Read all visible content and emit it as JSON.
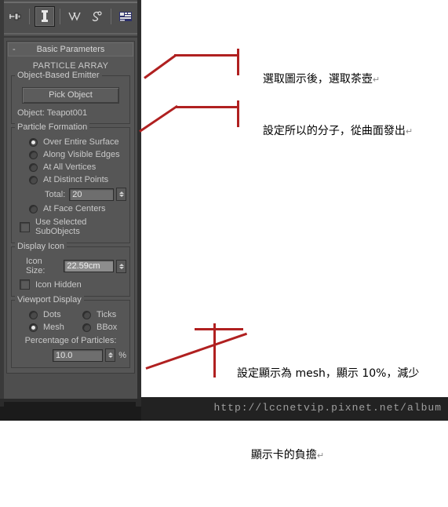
{
  "panel": {
    "toolbar": {
      "buttons": [
        {
          "name": "pin-stack-icon",
          "title": "Pin Stack",
          "selected": false
        },
        {
          "name": "show-end-result-icon",
          "title": "Show End Result",
          "selected": true
        },
        {
          "name": "make-unique-icon",
          "title": "Make Unique",
          "selected": false
        },
        {
          "name": "remove-modifier-icon",
          "title": "Remove Modifier",
          "selected": false
        },
        {
          "name": "configure-modifier-sets-icon",
          "title": "Configure Modifier Sets",
          "selected": false
        }
      ]
    },
    "rollout": {
      "collapse_sign": "-",
      "title": "Basic Parameters",
      "subtitle": "PARTICLE ARRAY"
    },
    "emitter_group": {
      "title": "Object-Based Emitter",
      "pick_object_label": "Pick Object",
      "object_label": "Object: Teapot001"
    },
    "particle_formation": {
      "title": "Particle Formation",
      "options": [
        {
          "label": "Over Entire Surface",
          "selected": true
        },
        {
          "label": "Along Visible Edges",
          "selected": false
        },
        {
          "label": "At All Vertices",
          "selected": false
        },
        {
          "label": "At Distinct Points",
          "selected": false
        },
        {
          "label": "At Face Centers",
          "selected": false
        }
      ],
      "total_label": "Total:",
      "total_value": "20",
      "use_subobjects_label": "Use Selected SubObjects",
      "use_subobjects_checked": false
    },
    "display_icon": {
      "title": "Display Icon",
      "icon_size_label": "Icon Size:",
      "icon_size_value": "22.59cm",
      "icon_hidden_label": "Icon Hidden",
      "icon_hidden_checked": false
    },
    "viewport_display": {
      "title": "Viewport Display",
      "options": [
        {
          "label": "Dots",
          "selected": false
        },
        {
          "label": "Ticks",
          "selected": false
        },
        {
          "label": "Mesh",
          "selected": true
        },
        {
          "label": "BBox",
          "selected": false
        }
      ],
      "percentage_label": "Percentage of Particles:",
      "percentage_value": "10.0",
      "percentage_unit": "%"
    }
  },
  "annotations": [
    {
      "name": "annotation-pick-teapot",
      "text": "選取圖示後，選取茶壺",
      "mark": "↵"
    },
    {
      "name": "annotation-particle-formation",
      "text": "設定所以的分子，從曲面發出",
      "mark": "↵"
    },
    {
      "name": "annotation-viewport-display",
      "line1": "設定顯示為 mesh，顯示 10%，減少",
      "line2": "顯示卡的負擔",
      "mark": "↵"
    }
  ],
  "footer": {
    "url": "http://lccnetvip.pixnet.net/album"
  },
  "colors": {
    "panel_bg": "#565656",
    "panel_outer": "#4e4e4e",
    "leader_red": "#b02020",
    "footer_bg": "#222222",
    "text_light": "#c9c9c9"
  }
}
